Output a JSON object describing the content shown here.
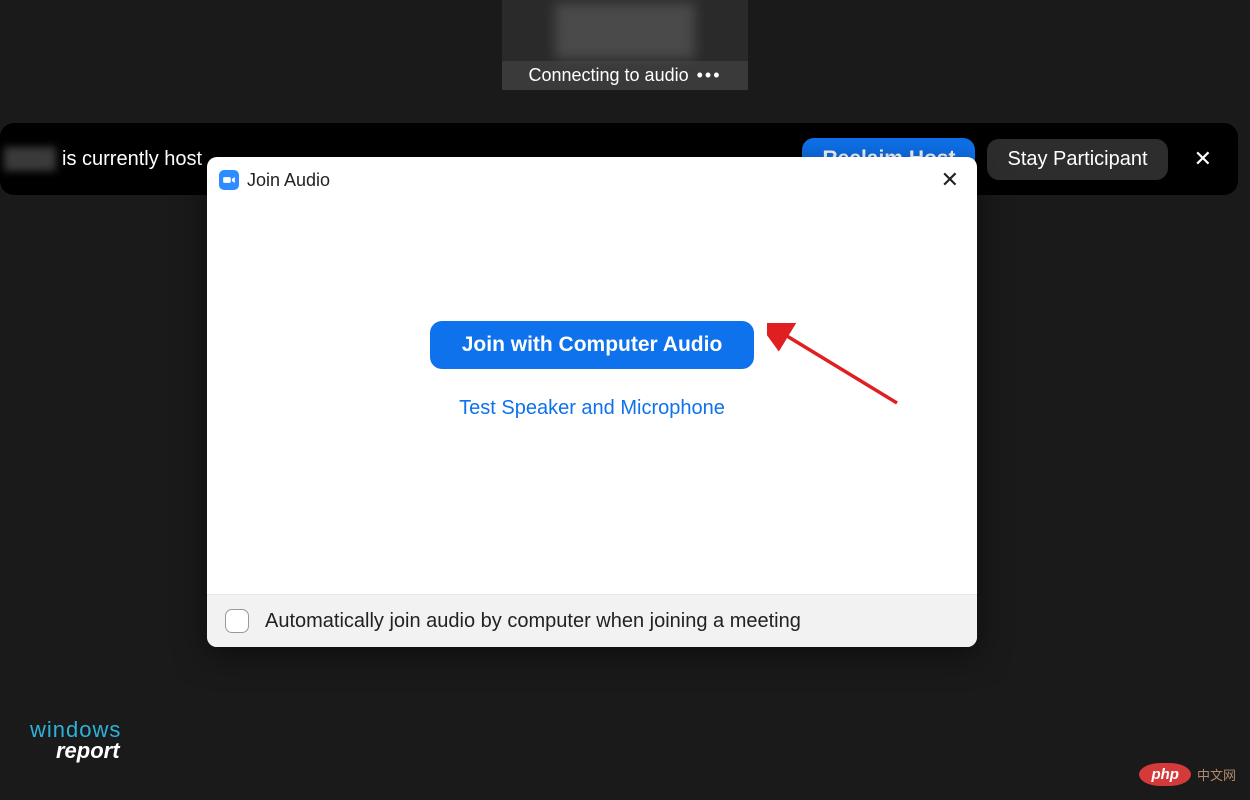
{
  "video": {
    "connecting_status": "Connecting to audio",
    "dots": "•••"
  },
  "notify": {
    "text_fragment": "is currently host",
    "reclaim_label": "Reclaim Host",
    "stay_label": "Stay Participant",
    "close_glyph": "✕"
  },
  "dialog": {
    "title": "Join Audio",
    "close_glyph": "✕",
    "join_button_label": "Join with Computer Audio",
    "test_link_label": "Test Speaker and Microphone",
    "auto_join_label": "Automatically join audio by computer when joining a meeting"
  },
  "watermark": {
    "wr_line1": "windows",
    "wr_line2": "report",
    "php_badge": "php",
    "php_text": "中文网"
  },
  "colors": {
    "primary_blue": "#0e72ed",
    "bg_dark": "#1a1a1a"
  }
}
